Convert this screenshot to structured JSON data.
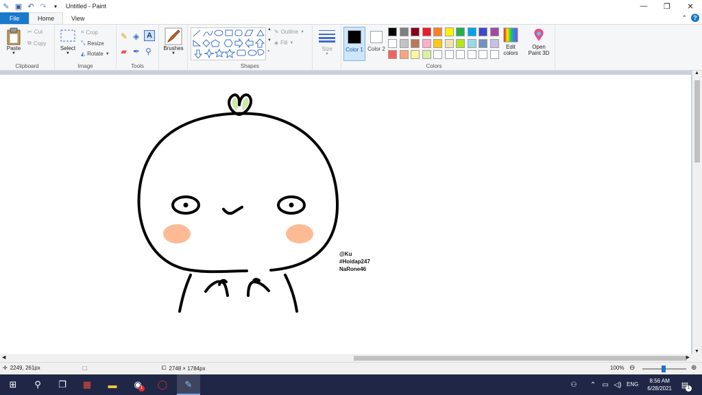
{
  "window": {
    "title": "Untitled - Paint",
    "controls": {
      "minimize": "—",
      "maximize": "❐",
      "close": "✕"
    }
  },
  "tabs": {
    "file": "File",
    "home": "Home",
    "view": "View"
  },
  "ribbon": {
    "clipboard": {
      "label": "Clipboard",
      "paste": "Paste",
      "cut": "Cut",
      "copy": "Copy"
    },
    "image": {
      "label": "Image",
      "select": "Select",
      "crop": "Crop",
      "resize": "Resize",
      "rotate": "Rotate"
    },
    "tools": {
      "label": "Tools"
    },
    "brushes": {
      "label": "Brushes"
    },
    "shapes": {
      "label": "Shapes",
      "outline": "Outline",
      "fill": "Fill"
    },
    "size": {
      "label": "Size"
    },
    "colors": {
      "label": "Colors",
      "color1": "Color 1",
      "color2": "Color 2",
      "edit_colors": "Edit colors",
      "color1_value": "#000000",
      "color2_value": "#ffffff",
      "palette_row1": [
        "#000000",
        "#7f7f7f",
        "#880015",
        "#ed1c24",
        "#ff7f27",
        "#fff200",
        "#22b14c",
        "#00a2e8",
        "#3f48cc",
        "#a349a4"
      ],
      "palette_row2": [
        "#ffffff",
        "#c3c3c3",
        "#b97a57",
        "#ffaec9",
        "#ffc90e",
        "#efe4b0",
        "#b5e61d",
        "#99d9ea",
        "#7092be",
        "#c8bfe7"
      ],
      "palette_row3": [
        "#f4645f",
        "#f6a67f",
        "#fff59d",
        "#d9f1a3",
        "#ffffff",
        "#ffffff",
        "#ffffff",
        "#ffffff",
        "#ffffff",
        "#ffffff"
      ]
    },
    "paint3d": {
      "label": "Open Paint 3D"
    }
  },
  "canvas": {
    "watermark_lines": [
      "@Ku",
      "#Hoidap247",
      "NaRone46"
    ],
    "blush_color": "#fdbb95",
    "leaf_color": "#cfe8a8"
  },
  "status": {
    "cursor_pos": "2249, 261px",
    "image_size": "2748 × 1784px",
    "zoom": "100%"
  },
  "taskbar": {
    "time": "8:56 AM",
    "date": "6/28/2021",
    "lang": "ENG",
    "chrome_badge": "1",
    "notif_badge": "1"
  }
}
